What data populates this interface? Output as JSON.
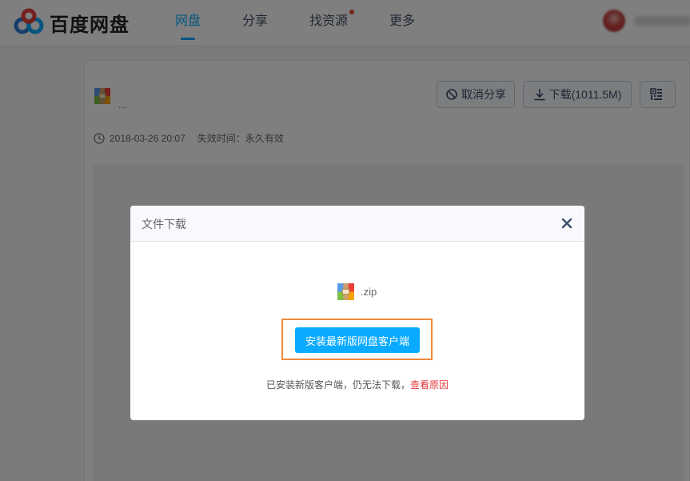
{
  "header": {
    "logo_text": "百度网盘",
    "nav": [
      {
        "label": "网盘",
        "active": true
      },
      {
        "label": "分享",
        "active": false
      },
      {
        "label": "找资源",
        "active": false,
        "badge_dot": true
      },
      {
        "label": "更多",
        "active": false
      }
    ]
  },
  "share": {
    "file_name": "...",
    "cancel_share_label": "取消分享",
    "download_label": "下载(1011.5M)",
    "created_time": "2018-03-26 20:07",
    "expiry_label": "失效时间：永久有效"
  },
  "dialog": {
    "title": "文件下载",
    "file_name": ".zip",
    "install_button": "安装最新版网盘客户端",
    "tip_prefix": "已安装新版客户端，仍无法下载，",
    "tip_link": "查看原因"
  },
  "colors": {
    "accent": "#09aaff",
    "highlight": "#f08a3a",
    "link": "#e4393c"
  },
  "icons": [
    "baidu-cloud-logo-icon",
    "block-icon",
    "download-icon",
    "qrcode-icon",
    "clock-icon",
    "close-icon",
    "zip-file-icon"
  ]
}
